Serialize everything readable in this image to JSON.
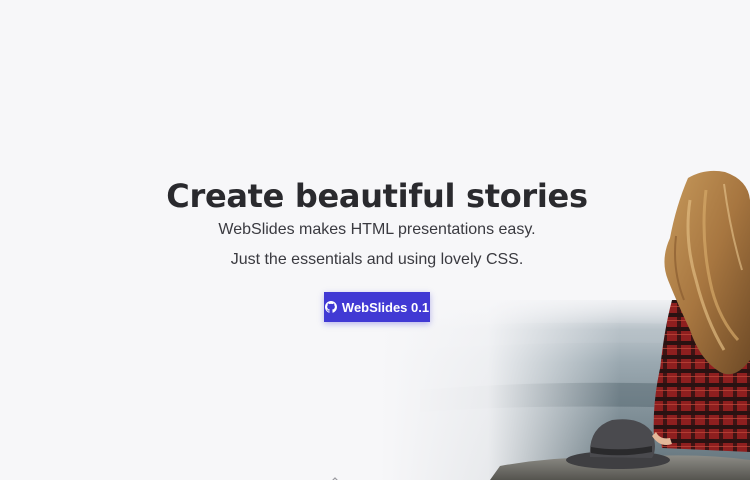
{
  "hero": {
    "title": "Create beautiful stories",
    "subtitle_line1": "WebSlides makes HTML presentations easy.",
    "subtitle_line2": "Just the essentials and using lovely CSS.",
    "button_label": "WebSlides 0.1",
    "button_icon": "github-icon"
  },
  "colors": {
    "background": "#f7f7f9",
    "title": "#2a2a2e",
    "subtitle": "#3a3a40",
    "button": "#4139d4",
    "button_text": "#ffffff"
  }
}
